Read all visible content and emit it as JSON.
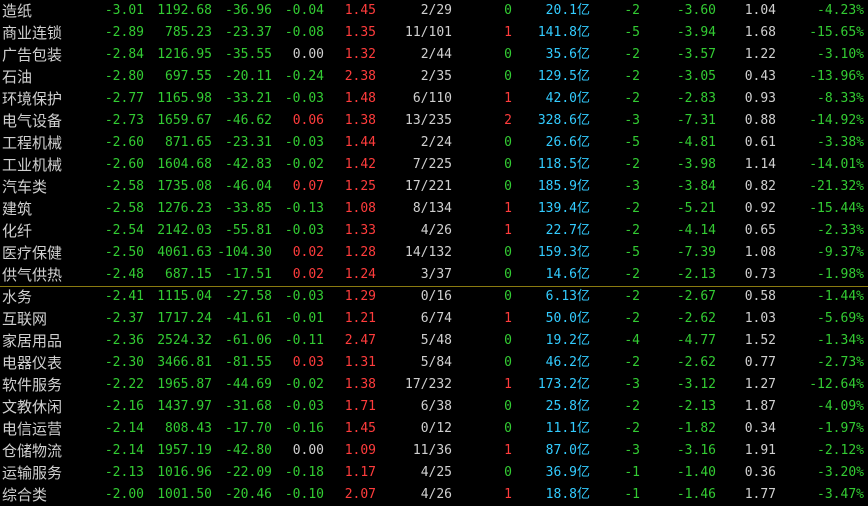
{
  "colors": {
    "background": "#000000",
    "down_green": "#33cc33",
    "up_red": "#ff3c3c",
    "neutral": "#d0d0d0",
    "cyan": "#33ccff",
    "separator": "#8a7a10"
  },
  "cap_unit": "亿",
  "rows": [
    {
      "name": "造纸",
      "change": "-3.01",
      "price": "1192.68",
      "delta": "-36.96",
      "speed": "-0.04",
      "ratio": "1.45",
      "count": "2/29",
      "lead": "0",
      "cap": "20.1",
      "n2": "-2",
      "d3": "-3.60",
      "vr": "1.04",
      "d20": "-4.23"
    },
    {
      "name": "商业连锁",
      "change": "-2.89",
      "price": "785.23",
      "delta": "-23.37",
      "speed": "-0.08",
      "ratio": "1.35",
      "count": "11/101",
      "lead": "1",
      "cap": "141.8",
      "n2": "-5",
      "d3": "-3.94",
      "vr": "1.68",
      "d20": "-15.65"
    },
    {
      "name": "广告包装",
      "change": "-2.84",
      "price": "1216.95",
      "delta": "-35.55",
      "speed": "0.00",
      "ratio": "1.32",
      "count": "2/44",
      "lead": "0",
      "cap": "35.6",
      "n2": "-2",
      "d3": "-3.57",
      "vr": "1.22",
      "d20": "-3.10"
    },
    {
      "name": "石油",
      "change": "-2.80",
      "price": "697.55",
      "delta": "-20.11",
      "speed": "-0.24",
      "ratio": "2.38",
      "count": "2/35",
      "lead": "0",
      "cap": "129.5",
      "n2": "-2",
      "d3": "-3.05",
      "vr": "0.43",
      "d20": "-13.96"
    },
    {
      "name": "环境保护",
      "change": "-2.77",
      "price": "1165.98",
      "delta": "-33.21",
      "speed": "-0.03",
      "ratio": "1.48",
      "count": "6/110",
      "lead": "1",
      "cap": "42.0",
      "n2": "-2",
      "d3": "-2.83",
      "vr": "0.93",
      "d20": "-8.33"
    },
    {
      "name": "电气设备",
      "change": "-2.73",
      "price": "1659.67",
      "delta": "-46.62",
      "speed": "0.06",
      "ratio": "1.38",
      "count": "13/235",
      "lead": "2",
      "cap": "328.6",
      "n2": "-3",
      "d3": "-7.31",
      "vr": "0.88",
      "d20": "-14.92"
    },
    {
      "name": "工程机械",
      "change": "-2.60",
      "price": "871.65",
      "delta": "-23.31",
      "speed": "-0.03",
      "ratio": "1.44",
      "count": "2/24",
      "lead": "0",
      "cap": "26.6",
      "n2": "-5",
      "d3": "-4.81",
      "vr": "0.61",
      "d20": "-3.38"
    },
    {
      "name": "工业机械",
      "change": "-2.60",
      "price": "1604.68",
      "delta": "-42.83",
      "speed": "-0.02",
      "ratio": "1.42",
      "count": "7/225",
      "lead": "0",
      "cap": "118.5",
      "n2": "-2",
      "d3": "-3.98",
      "vr": "1.14",
      "d20": "-14.01"
    },
    {
      "name": "汽车类",
      "change": "-2.58",
      "price": "1735.08",
      "delta": "-46.04",
      "speed": "0.07",
      "ratio": "1.25",
      "count": "17/221",
      "lead": "0",
      "cap": "185.9",
      "n2": "-3",
      "d3": "-3.84",
      "vr": "0.82",
      "d20": "-21.32"
    },
    {
      "name": "建筑",
      "change": "-2.58",
      "price": "1276.23",
      "delta": "-33.85",
      "speed": "-0.13",
      "ratio": "1.08",
      "count": "8/134",
      "lead": "1",
      "cap": "139.4",
      "n2": "-2",
      "d3": "-5.21",
      "vr": "0.92",
      "d20": "-15.44"
    },
    {
      "name": "化纤",
      "change": "-2.54",
      "price": "2142.03",
      "delta": "-55.81",
      "speed": "-0.03",
      "ratio": "1.33",
      "count": "4/26",
      "lead": "1",
      "cap": "22.7",
      "n2": "-2",
      "d3": "-4.14",
      "vr": "0.65",
      "d20": "-2.33"
    },
    {
      "name": "医疗保健",
      "change": "-2.50",
      "price": "4061.63",
      "delta": "-104.30",
      "speed": "0.02",
      "ratio": "1.28",
      "count": "14/132",
      "lead": "0",
      "cap": "159.3",
      "n2": "-5",
      "d3": "-7.39",
      "vr": "1.08",
      "d20": "-9.37"
    },
    {
      "name": "供气供热",
      "change": "-2.48",
      "price": "687.15",
      "delta": "-17.51",
      "speed": "0.02",
      "ratio": "1.24",
      "count": "3/37",
      "lead": "0",
      "cap": "14.6",
      "n2": "-2",
      "d3": "-2.13",
      "vr": "0.73",
      "d20": "-1.98"
    },
    {
      "name": "水务",
      "change": "-2.41",
      "price": "1115.04",
      "delta": "-27.58",
      "speed": "-0.03",
      "ratio": "1.29",
      "count": "0/16",
      "lead": "0",
      "cap": "6.13",
      "n2": "-2",
      "d3": "-2.67",
      "vr": "0.58",
      "d20": "-1.44"
    },
    {
      "name": "互联网",
      "change": "-2.37",
      "price": "1717.24",
      "delta": "-41.61",
      "speed": "-0.01",
      "ratio": "1.21",
      "count": "6/74",
      "lead": "1",
      "cap": "50.0",
      "n2": "-2",
      "d3": "-2.62",
      "vr": "1.03",
      "d20": "-5.69"
    },
    {
      "name": "家居用品",
      "change": "-2.36",
      "price": "2524.32",
      "delta": "-61.06",
      "speed": "-0.11",
      "ratio": "2.47",
      "count": "5/48",
      "lead": "0",
      "cap": "19.2",
      "n2": "-4",
      "d3": "-4.77",
      "vr": "1.52",
      "d20": "-1.34"
    },
    {
      "name": "电器仪表",
      "change": "-2.30",
      "price": "3466.81",
      "delta": "-81.55",
      "speed": "0.03",
      "ratio": "1.31",
      "count": "5/84",
      "lead": "0",
      "cap": "46.2",
      "n2": "-2",
      "d3": "-2.62",
      "vr": "0.77",
      "d20": "-2.73"
    },
    {
      "name": "软件服务",
      "change": "-2.22",
      "price": "1965.87",
      "delta": "-44.69",
      "speed": "-0.02",
      "ratio": "1.38",
      "count": "17/232",
      "lead": "1",
      "cap": "173.2",
      "n2": "-3",
      "d3": "-3.12",
      "vr": "1.27",
      "d20": "-12.64"
    },
    {
      "name": "文教休闲",
      "change": "-2.16",
      "price": "1437.97",
      "delta": "-31.68",
      "speed": "-0.03",
      "ratio": "1.71",
      "count": "6/38",
      "lead": "0",
      "cap": "25.8",
      "n2": "-2",
      "d3": "-2.13",
      "vr": "1.87",
      "d20": "-4.09"
    },
    {
      "name": "电信运营",
      "change": "-2.14",
      "price": "808.43",
      "delta": "-17.70",
      "speed": "-0.16",
      "ratio": "1.45",
      "count": "0/12",
      "lead": "0",
      "cap": "11.1",
      "n2": "-2",
      "d3": "-1.82",
      "vr": "0.34",
      "d20": "-1.97"
    },
    {
      "name": "仓储物流",
      "change": "-2.14",
      "price": "1957.19",
      "delta": "-42.80",
      "speed": "0.00",
      "ratio": "1.09",
      "count": "11/36",
      "lead": "1",
      "cap": "87.0",
      "n2": "-3",
      "d3": "-3.16",
      "vr": "1.91",
      "d20": "-2.12"
    },
    {
      "name": "运输服务",
      "change": "-2.13",
      "price": "1016.96",
      "delta": "-22.09",
      "speed": "-0.18",
      "ratio": "1.17",
      "count": "4/25",
      "lead": "0",
      "cap": "36.9",
      "n2": "-1",
      "d3": "-1.40",
      "vr": "0.36",
      "d20": "-3.20"
    },
    {
      "name": "综合类",
      "change": "-2.00",
      "price": "1001.50",
      "delta": "-20.46",
      "speed": "-0.10",
      "ratio": "2.07",
      "count": "4/26",
      "lead": "1",
      "cap": "18.8",
      "n2": "-1",
      "d3": "-1.46",
      "vr": "1.77",
      "d20": "-3.47"
    }
  ]
}
